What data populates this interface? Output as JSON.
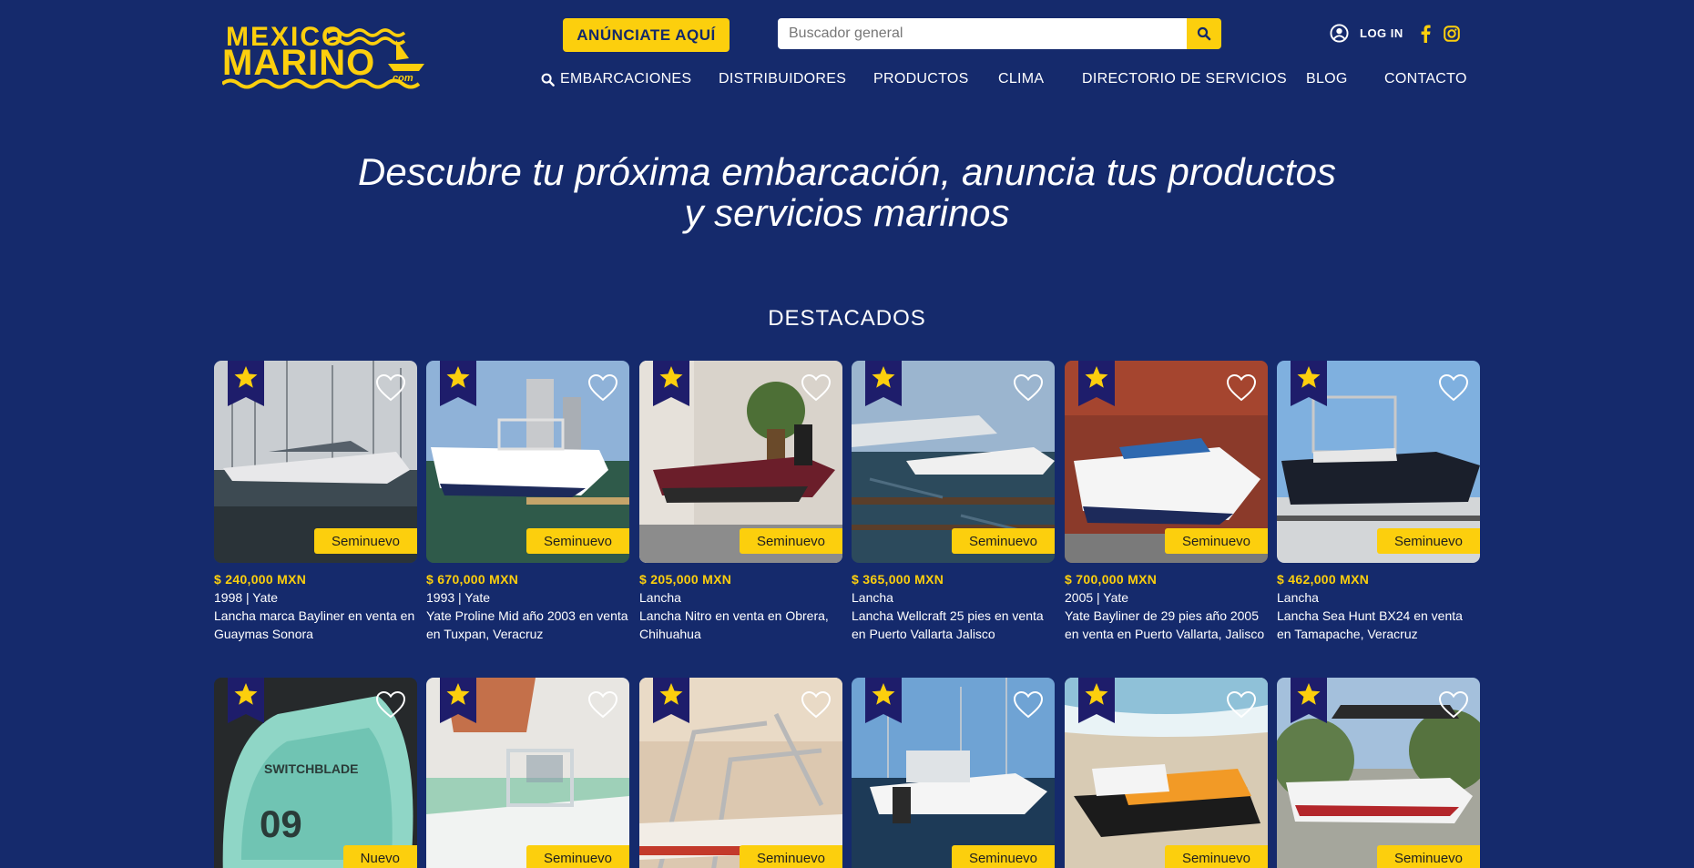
{
  "header": {
    "logo_line1": "MEXICO",
    "logo_line2": "MARINO",
    "logo_suffix": ".com",
    "cta_label": "ANÚNCIATE AQUÍ",
    "search_placeholder": "Buscador general",
    "login_label": "LOG IN"
  },
  "nav": {
    "items": [
      {
        "label": "EMBARCACIONES"
      },
      {
        "label": "DISTRIBUIDORES"
      },
      {
        "label": "PRODUCTOS"
      },
      {
        "label": "CLIMA"
      },
      {
        "label": "DIRECTORIO DE SERVICIOS"
      },
      {
        "label": "BLOG"
      },
      {
        "label": "CONTACTO"
      }
    ]
  },
  "hero": {
    "line1": "Descubre tu próxima embarcación, anuncia tus productos",
    "line2": "y servicios marinos"
  },
  "featured": {
    "title": "DESTACADOS",
    "cards": [
      {
        "price": "$ 240,000 MXN",
        "meta": "1998 | Yate",
        "title": "Lancha marca Bayliner en venta en Guaymas Sonora",
        "badge": "Seminuevo",
        "photo": "marina-cruiser"
      },
      {
        "price": "$ 670,000 MXN",
        "meta": "1993 | Yate",
        "title": "Yate Proline Mid año 2003 en venta en Tuxpan, Veracruz",
        "badge": "Seminuevo",
        "photo": "center-console-dock"
      },
      {
        "price": "$ 205,000 MXN",
        "meta": "Lancha",
        "title": "Lancha Nitro en venta en Obrera, Chihuahua",
        "badge": "Seminuevo",
        "photo": "bass-boat-trailer"
      },
      {
        "price": "$ 365,000 MXN",
        "meta": "Lancha",
        "title": "Lancha Wellcraft 25 pies en venta en Puerto Vallarta Jalisco",
        "badge": "Seminuevo",
        "photo": "marina-docks"
      },
      {
        "price": "$ 700,000 MXN",
        "meta": "2005 | Yate",
        "title": "Yate Bayliner de 29 pies año 2005 en venta en Puerto Vallarta, Jalisco",
        "badge": "Seminuevo",
        "photo": "cruiser-trailer"
      },
      {
        "price": "$ 462,000 MXN",
        "meta": "Lancha",
        "title": "Lancha Sea Hunt BX24 en venta en Tamapache, Veracruz",
        "badge": "Seminuevo",
        "photo": "center-console-sky"
      },
      {
        "price": "",
        "meta": "",
        "title": "",
        "badge": "Nuevo",
        "photo": "kite"
      },
      {
        "price": "",
        "meta": "",
        "title": "",
        "badge": "Seminuevo",
        "photo": "flats-boat"
      },
      {
        "price": "",
        "meta": "",
        "title": "",
        "badge": "Seminuevo",
        "photo": "tower-detail"
      },
      {
        "price": "",
        "meta": "",
        "title": "",
        "badge": "Seminuevo",
        "photo": "sport-fisher"
      },
      {
        "price": "",
        "meta": "",
        "title": "",
        "badge": "Seminuevo",
        "photo": "jet-ski"
      },
      {
        "price": "",
        "meta": "",
        "title": "",
        "badge": "Seminuevo",
        "photo": "wake-boat"
      }
    ]
  },
  "colors": {
    "background": "#152a6c",
    "accent": "#fccf0d",
    "ribbon": "#1e1d6b"
  }
}
